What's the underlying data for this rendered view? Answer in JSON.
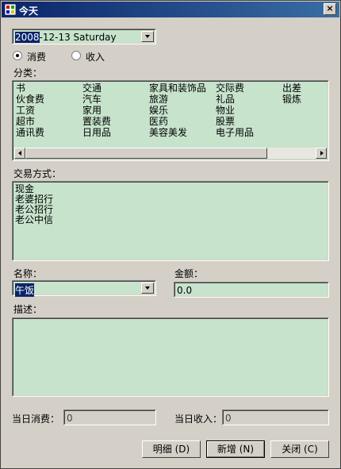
{
  "window": {
    "title": "今天",
    "close_glyph": "×"
  },
  "date_picker": {
    "year_selected": "2008",
    "rest": "-12-13   Saturday"
  },
  "type_radio": [
    {
      "label": "消费",
      "checked": true
    },
    {
      "label": "收入",
      "checked": false
    }
  ],
  "category": {
    "label": "分类：",
    "columns": [
      [
        "书",
        "伙食费",
        "工资",
        "超市",
        "通讯费"
      ],
      [
        "交通",
        "汽车",
        "家用",
        "置装费",
        "日用品"
      ],
      [
        "家具和装饰品",
        "旅游",
        "娱乐",
        "医药",
        "美容美发"
      ],
      [
        "交际费",
        "礼品",
        "物业",
        "股票",
        "电子用品"
      ],
      [
        "出差",
        "锻炼"
      ]
    ]
  },
  "payment": {
    "label": "交易方式：",
    "items": [
      "现金",
      "老婆招行",
      "老公招行",
      "老公中信"
    ]
  },
  "name": {
    "label": "名称：",
    "value": "午饭"
  },
  "amount": {
    "label": "金额：",
    "value": "0.0"
  },
  "description": {
    "label": "描述：",
    "value": ""
  },
  "daily_expense": {
    "label": "当日消费：",
    "value": "0"
  },
  "daily_income": {
    "label": "当日收入：",
    "value": "0"
  },
  "buttons": {
    "details": "明细 (D)",
    "add": "新增 (N)",
    "close": "关闭 (C)"
  }
}
